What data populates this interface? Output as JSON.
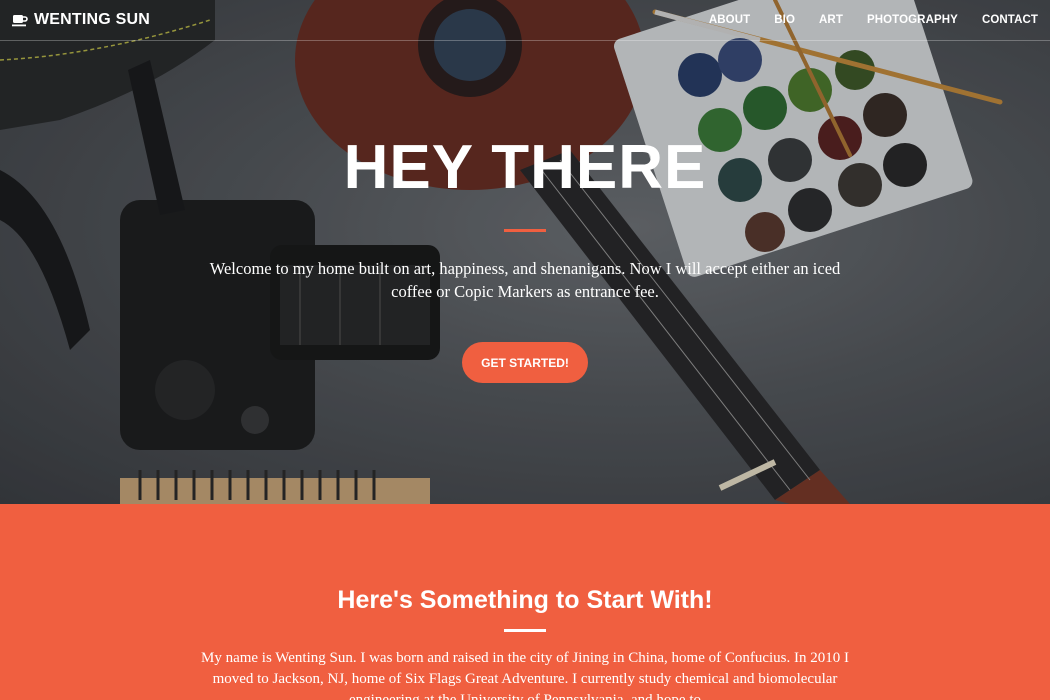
{
  "navbar": {
    "brand_icon": "coffee-cup-icon",
    "brand": "WENTING SUN",
    "links": [
      "ABOUT",
      "BIO",
      "ART",
      "PHOTOGRAPHY",
      "CONTACT"
    ]
  },
  "hero": {
    "title": "HEY THERE",
    "text": "Welcome to my home built on art, happiness, and shenanigans. Now I will accept either an iced coffee or Copic Markers as entrance fee.",
    "button": "GET STARTED!"
  },
  "about": {
    "title": "Here's Something to Start With!",
    "text": "My name is Wenting Sun. I was born and raised in the city of Jining in China, home of Confucius. In 2010 I moved to Jackson, NJ, home of Six Flags Great Adventure. I currently study chemical and biomolecular engineering at the University of Pennsylvania, and hope to"
  },
  "colors": {
    "accent": "#f05f40",
    "text": "#ffffff"
  }
}
